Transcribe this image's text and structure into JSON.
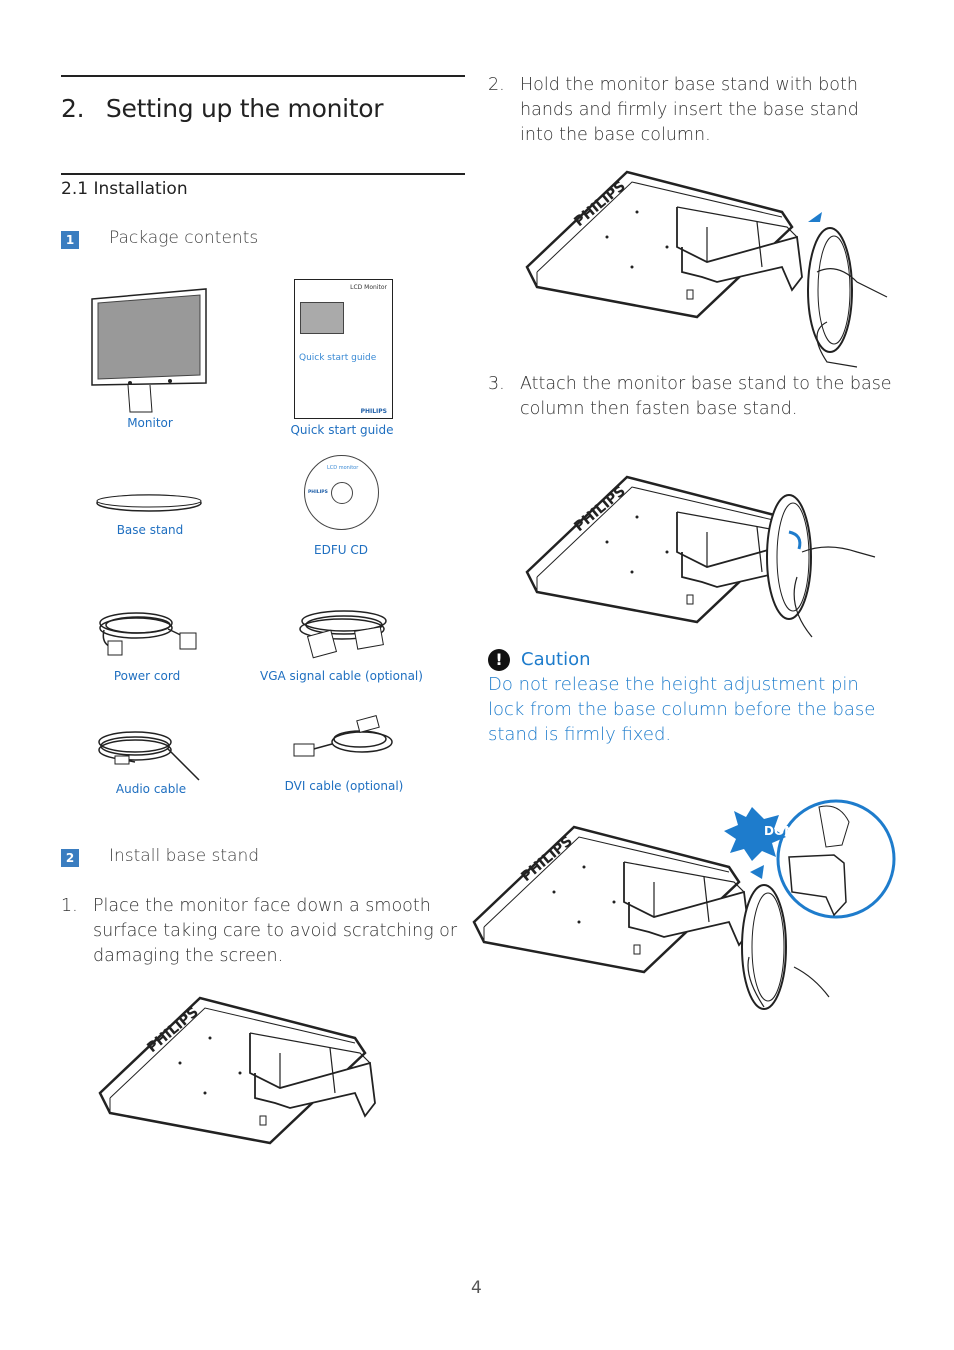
{
  "section": {
    "number": "2.",
    "title": "Setting up the monitor"
  },
  "subsection": {
    "number": "2.1",
    "title": "Installation"
  },
  "steps": [
    {
      "badge": "1",
      "title": "Package contents"
    },
    {
      "badge": "2",
      "title": "Install base stand"
    }
  ],
  "package_items": [
    {
      "label": "Monitor"
    },
    {
      "label": "Quick start guide"
    },
    {
      "label": "Base stand"
    },
    {
      "label": "EDFU CD"
    },
    {
      "label": "Power cord"
    },
    {
      "label": "VGA signal cable (optional)"
    },
    {
      "label": "Audio cable"
    },
    {
      "label": "DVI cable (optional)"
    }
  ],
  "guide_cover": {
    "title": "LCD Monitor",
    "subtitle": "Quick start guide",
    "brand": "PHILIPS"
  },
  "cd": {
    "title": "LCD monitor",
    "brand": "PHILIPS"
  },
  "instructions": [
    {
      "number": "1.",
      "text": "Place the monitor face down a smooth surface taking care to avoid scratching or damaging the screen."
    },
    {
      "number": "2.",
      "text": "Hold the monitor base stand with both hands and firmly insert the base stand into the base column."
    },
    {
      "number": "3.",
      "text": "Attach the monitor base stand to the base column then fasten base stand."
    }
  ],
  "caution": {
    "title": "Caution",
    "text": "Do not release the height adjustment pin lock from the base column before the base stand is firmly fixed.",
    "icon": "exclamation-circle-icon"
  },
  "dont_badge": "DON'T",
  "monitor_brand": "PHILIPS",
  "page_number": "4",
  "colors": {
    "accent": "#1e7ccc",
    "badge": "#3a7dc0",
    "text": "#333333"
  }
}
